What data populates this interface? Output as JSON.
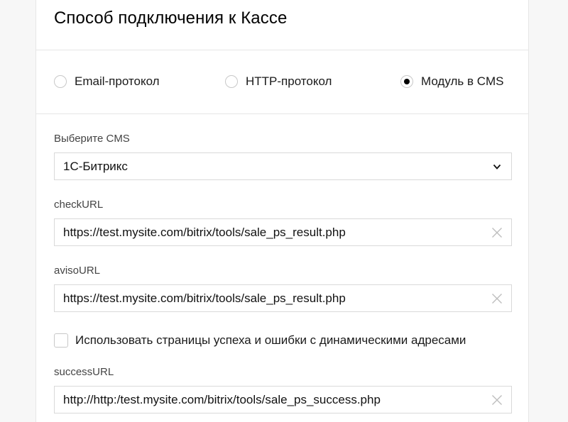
{
  "title": "Способ подключения к Кассе",
  "connection": {
    "options": [
      {
        "label": "Email-протокол",
        "checked": false
      },
      {
        "label": "HTTP-протокол",
        "checked": false
      },
      {
        "label": "Модуль в CMS",
        "checked": true
      }
    ]
  },
  "cms": {
    "label": "Выберите CMS",
    "selected": "1С-Битрикс"
  },
  "check_url": {
    "label": "checkURL",
    "value": "https://test.mysite.com/bitrix/tools/sale_ps_result.php"
  },
  "aviso_url": {
    "label": "avisoURL",
    "value": "https://test.mysite.com/bitrix/tools/sale_ps_result.php"
  },
  "dynamic_pages": {
    "label": "Использовать страницы успеха и ошибки с динамическими адресами",
    "checked": false
  },
  "success_url": {
    "label": "successURL",
    "value": "http://http:/test.mysite.com/bitrix/tools/sale_ps_success.php"
  },
  "icons": {
    "select_arrow": "chevron-down-icon",
    "clear": "close-icon"
  }
}
